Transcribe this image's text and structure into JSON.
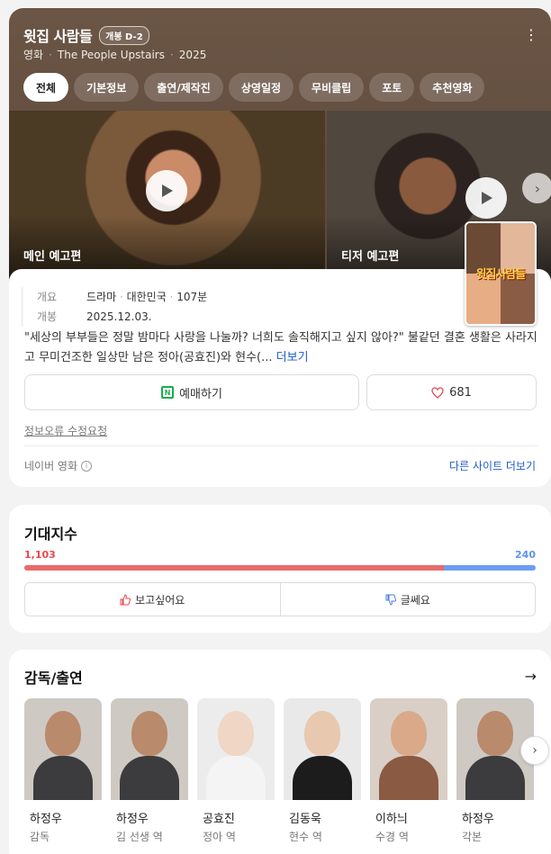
{
  "header": {
    "title": "윗집 사람들",
    "badge": "개봉 D-2",
    "category": "영화",
    "english_title": "The People Upstairs",
    "year": "2025"
  },
  "tabs": [
    "전체",
    "기본정보",
    "출연/제작진",
    "상영일정",
    "무비클립",
    "포토",
    "추천영화"
  ],
  "videos": [
    {
      "label": "메인 예고편"
    },
    {
      "label": "티저 예고편"
    }
  ],
  "poster": {
    "title": "윗집사람들"
  },
  "meta": {
    "overview_key": "개요",
    "genre": "드라마",
    "country": "대한민국",
    "runtime": "107분",
    "release_key": "개봉",
    "release_date": "2025.12.03."
  },
  "synopsis": {
    "text": "\"세상의 부부들은 정말 밤마다 사랑을 나눌까? 너희도 솔직해지고 싶지 않아?\" 불같던 결혼 생활은 사라지고 무미건조한 일상만 남은 정아(공효진)와 현수(...",
    "more": "더보기"
  },
  "actions": {
    "reserve": "예매하기",
    "like_count": "681"
  },
  "report": "정보오류 수정요청",
  "source": {
    "name": "네이버 영화",
    "other_sites": "다른 사이트 더보기"
  },
  "expectation": {
    "title": "기대지수",
    "want": "1,103",
    "meh": "240",
    "want_ratio": 0.821,
    "want_label": "보고싶어요",
    "meh_label": "글쎄요"
  },
  "cast": {
    "title": "감독/출연",
    "people": [
      {
        "name": "하정우",
        "role": "감독",
        "bg": "#cfc9c4"
      },
      {
        "name": "하정우",
        "role": "김 선생 역",
        "bg": "#cfc9c4"
      },
      {
        "name": "공효진",
        "role": "정아 역",
        "bg": "#ececec"
      },
      {
        "name": "김동욱",
        "role": "현수 역",
        "bg": "#e9e9e9"
      },
      {
        "name": "이하늬",
        "role": "수경 역",
        "bg": "#d9cfc7"
      },
      {
        "name": "하정우",
        "role": "각본",
        "bg": "#cfc9c4"
      }
    ]
  },
  "colors": {
    "want": "#e96b6b",
    "meh": "#6e9cf2",
    "link": "#1e5cc8"
  }
}
